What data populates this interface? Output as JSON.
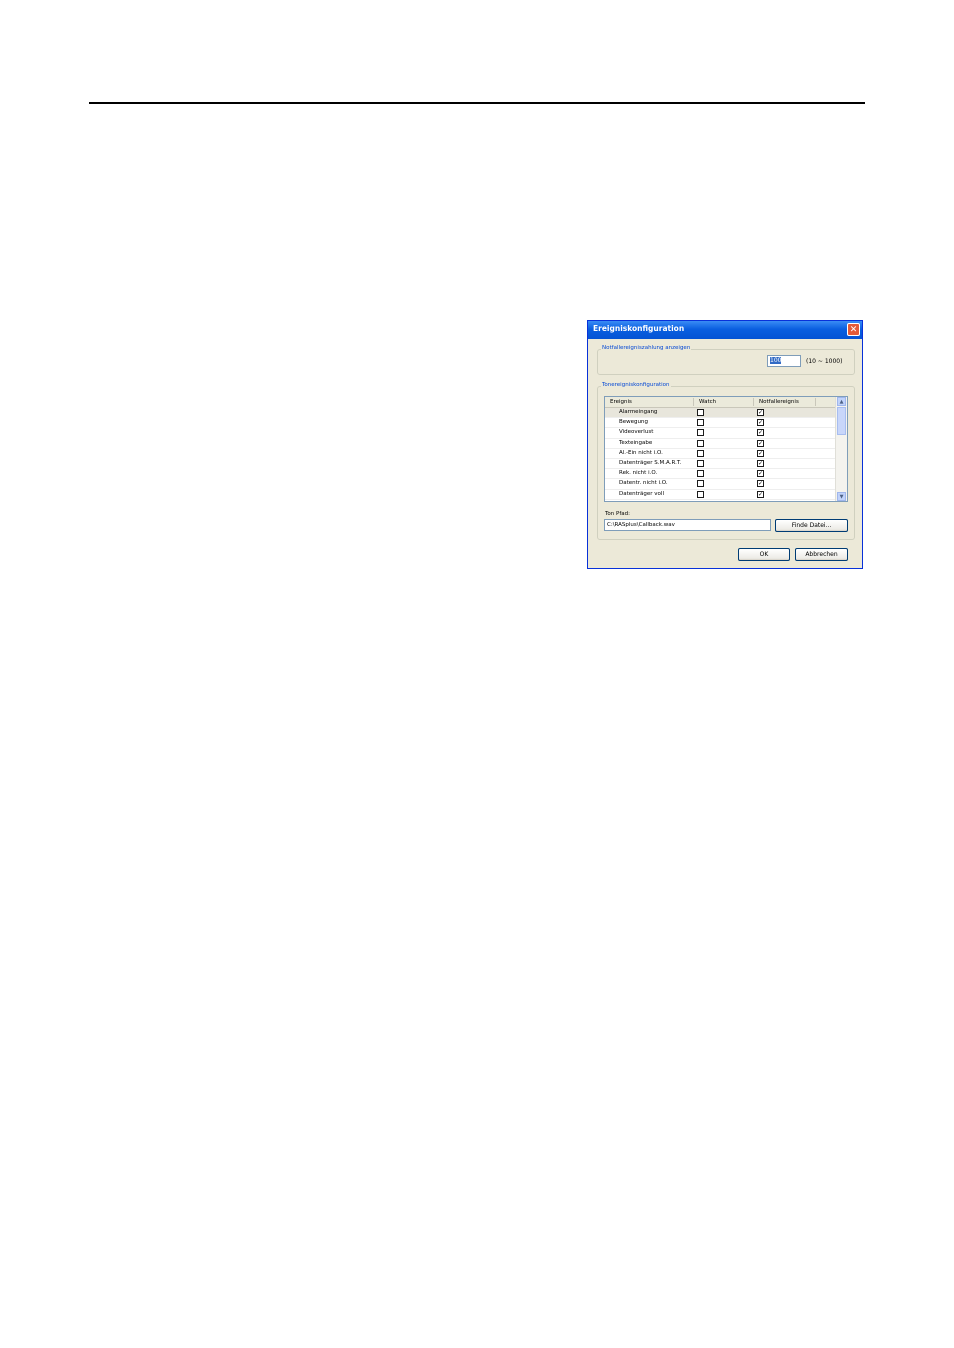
{
  "dialog": {
    "title": "Ereigniskonfiguration",
    "close_icon": "close-icon"
  },
  "emergency_group": {
    "legend": "Notfallereigniszahlung anzeigen",
    "count_value": "100",
    "range_text": "(10 ~ 1000)"
  },
  "sound_group": {
    "legend": "Tonereigniskonfiguration",
    "columns": [
      "Ereignis",
      "Watch",
      "Notfallereignis"
    ],
    "rows": [
      {
        "name": "Alarmeingang",
        "watch": false,
        "notfall": true,
        "selected": true
      },
      {
        "name": "Bewegung",
        "watch": false,
        "notfall": true
      },
      {
        "name": "Videoverlust",
        "watch": false,
        "notfall": true
      },
      {
        "name": "Texteingabe",
        "watch": false,
        "notfall": true
      },
      {
        "name": "Al.-Ein nicht i.O.",
        "watch": false,
        "notfall": true
      },
      {
        "name": "Datenträger S.M.A.R.T.",
        "watch": false,
        "notfall": true
      },
      {
        "name": "Rek. nicht i.O.",
        "watch": false,
        "notfall": true
      },
      {
        "name": "Datentr. nicht i.O.",
        "watch": false,
        "notfall": true
      },
      {
        "name": "Datenträger voll",
        "watch": false,
        "notfall": true
      }
    ],
    "path_label": "Ton Pfad:",
    "path_value": "C:\\RASplus\\Callback.wav",
    "find_button": "Finde Datei..."
  },
  "footer": {
    "ok_button": "OK",
    "cancel_button": "Abbrechen"
  },
  "colors": {
    "titlebar": "#0a5fe0",
    "dialog_bg": "#ece9d8",
    "legend_text": "#0046d5",
    "close_button": "#e35a38"
  }
}
